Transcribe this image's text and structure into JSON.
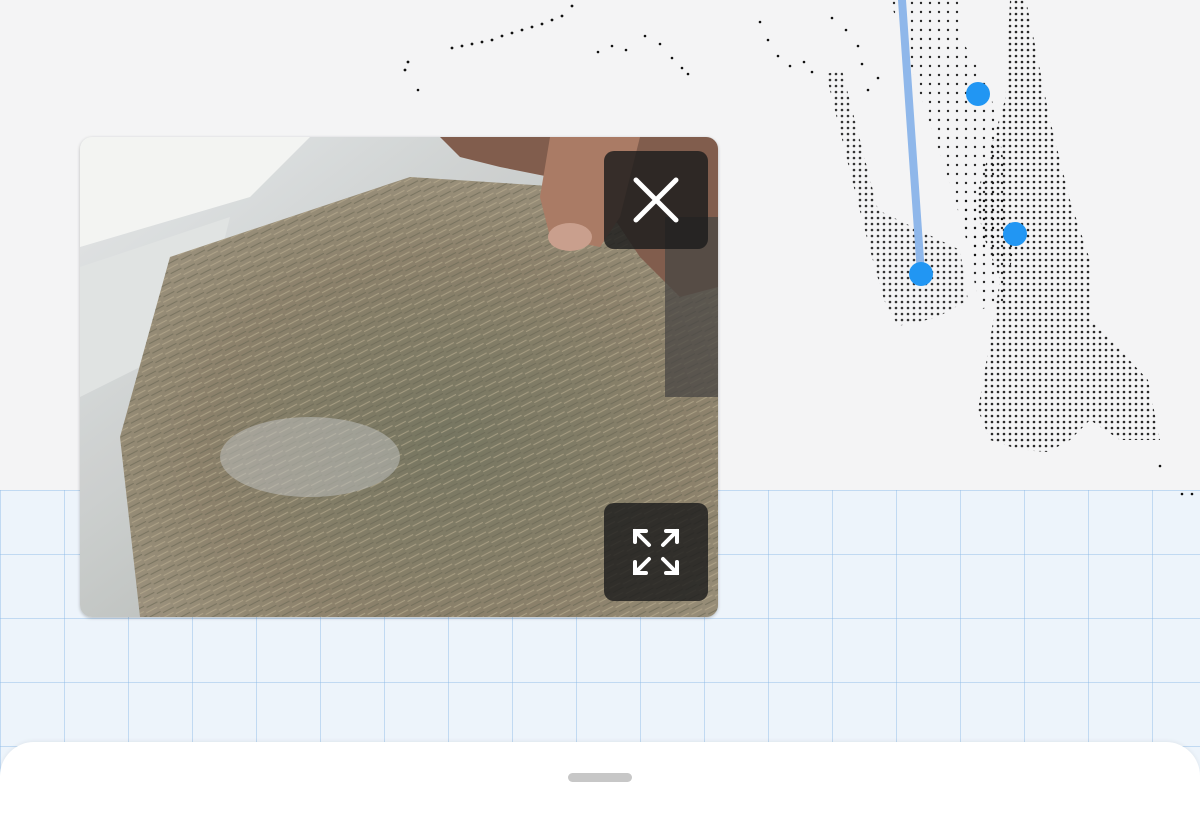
{
  "map": {
    "accent_color": "#2196f3",
    "measure_line_color": "#8fb7ea",
    "grid_color": "#b6d2ef"
  },
  "camera_preview": {
    "close_icon": "close-icon",
    "expand_icon": "fullscreen-expand-icon"
  },
  "bottom_sheet": {
    "handle_icon": "drag-handle"
  }
}
